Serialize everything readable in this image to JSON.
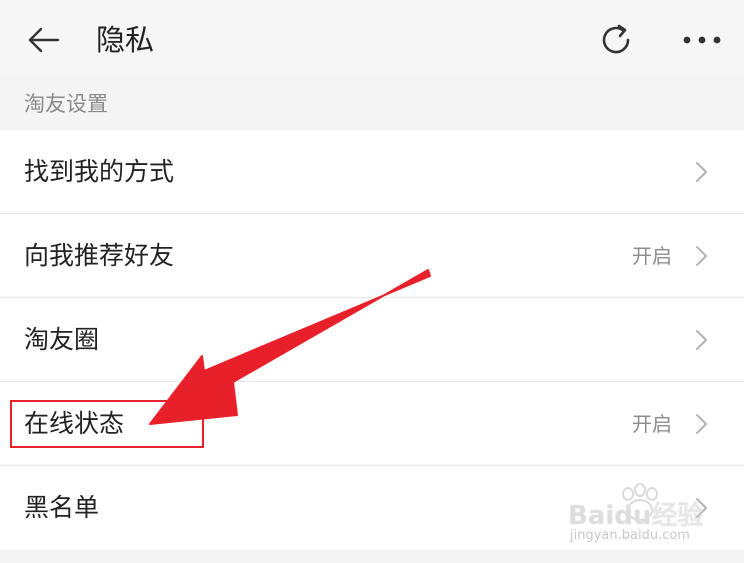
{
  "header": {
    "title": "隐私",
    "back_icon": "arrow-left-icon",
    "refresh_icon": "refresh-icon",
    "more_icon": "more-horizontal-icon"
  },
  "section": {
    "title": "淘友设置"
  },
  "rows": [
    {
      "label": "找到我的方式",
      "value": ""
    },
    {
      "label": "向我推荐好友",
      "value": "开启"
    },
    {
      "label": "淘友圈",
      "value": ""
    },
    {
      "label": "在线状态",
      "value": "开启"
    },
    {
      "label": "黑名单",
      "value": ""
    }
  ],
  "annotation": {
    "arrow_color": "#e8202a",
    "highlight_color": "#e8202a"
  },
  "watermark": {
    "logo_text": "Baidu经验",
    "url_text": "jingyan.baidu.com"
  }
}
